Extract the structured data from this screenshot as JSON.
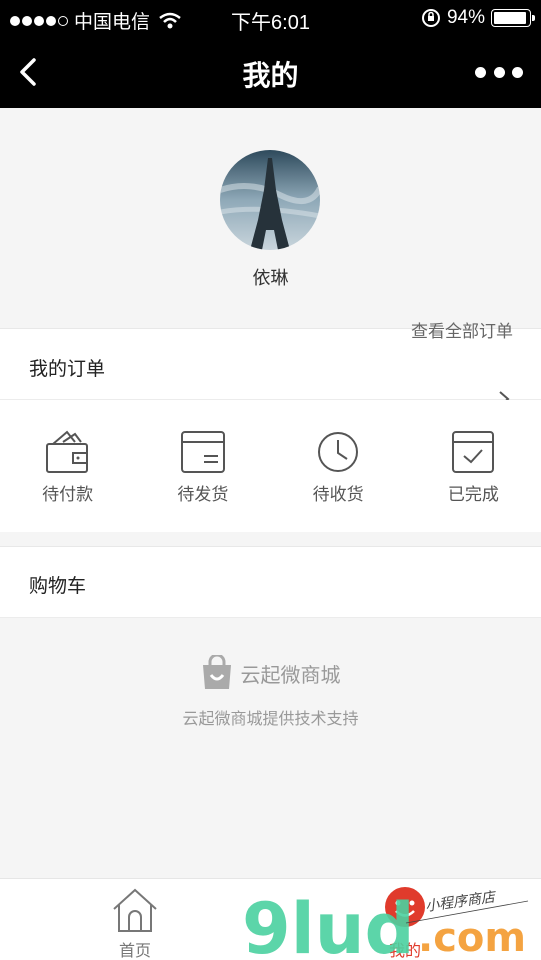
{
  "status_bar": {
    "carrier": "中国电信",
    "time": "下午6:01",
    "battery": "94%",
    "battery_level": 0.94
  },
  "navbar": {
    "title": "我的"
  },
  "profile": {
    "username": "依琳"
  },
  "orders": {
    "title": "我的订单",
    "view_all": "查看全部订单",
    "statuses": [
      {
        "label": "待付款",
        "icon": "wallet-icon"
      },
      {
        "label": "待发货",
        "icon": "box-icon"
      },
      {
        "label": "待收货",
        "icon": "clock-icon"
      },
      {
        "label": "已完成",
        "icon": "checked-box-icon"
      }
    ]
  },
  "cart": {
    "title": "购物车"
  },
  "footer": {
    "brand": "云起微商城",
    "support": "云起微商城提供技术支持"
  },
  "tabbar": {
    "home": "首页",
    "mine": "我的"
  },
  "watermark": {
    "text": "9lud.com",
    "tagline": "小程序商店"
  },
  "colors": {
    "accent": "#e03b2c",
    "watermark_green": "#4bd1a0",
    "watermark_orange": "#f39a2d"
  }
}
